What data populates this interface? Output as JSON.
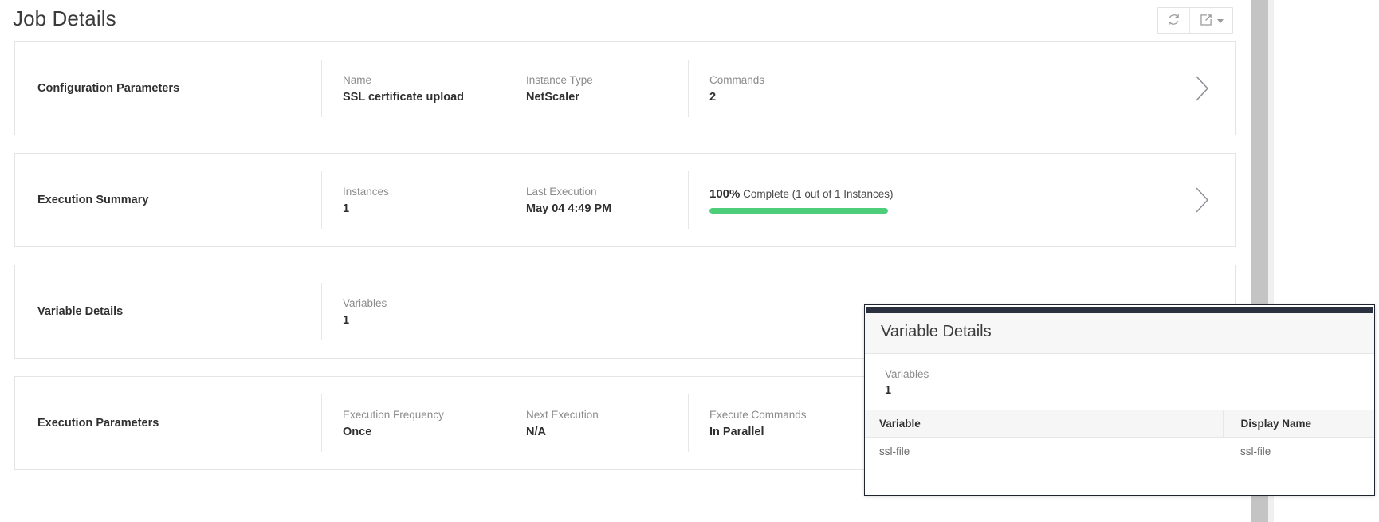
{
  "header": {
    "title": "Job Details",
    "actions": [
      {
        "name": "refresh-icon",
        "label": "Refresh"
      },
      {
        "name": "export-icon",
        "label": "Export"
      }
    ]
  },
  "cards": [
    {
      "label": "Configuration Parameters",
      "fields": [
        {
          "label": "Name",
          "value": "SSL certificate upload"
        },
        {
          "label": "Instance Type",
          "value": "NetScaler"
        },
        {
          "label": "Commands",
          "value": "2"
        }
      ]
    },
    {
      "label": "Execution Summary",
      "fields": [
        {
          "label": "Instances",
          "value": "1"
        },
        {
          "label": "Last Execution",
          "value": "May 04 4:49 PM"
        }
      ],
      "progress": {
        "percent": "100%",
        "text": "Complete (1 out of 1 Instances)",
        "value": 100,
        "color": "#4ece7b"
      }
    },
    {
      "label": "Variable Details",
      "fields": [
        {
          "label": "Variables",
          "value": "1"
        }
      ]
    },
    {
      "label": "Execution Parameters",
      "fields": [
        {
          "label": "Execution Frequency",
          "value": "Once"
        },
        {
          "label": "Next Execution",
          "value": "N/A"
        },
        {
          "label": "Execute Commands",
          "value": "In Parallel"
        }
      ]
    }
  ],
  "overlay": {
    "title": "Variable Details",
    "summary": {
      "label": "Variables",
      "value": "1"
    },
    "table": {
      "columns": [
        "Variable",
        "Display Name"
      ],
      "rows": [
        [
          "ssl-file",
          "ssl-file"
        ]
      ]
    }
  }
}
